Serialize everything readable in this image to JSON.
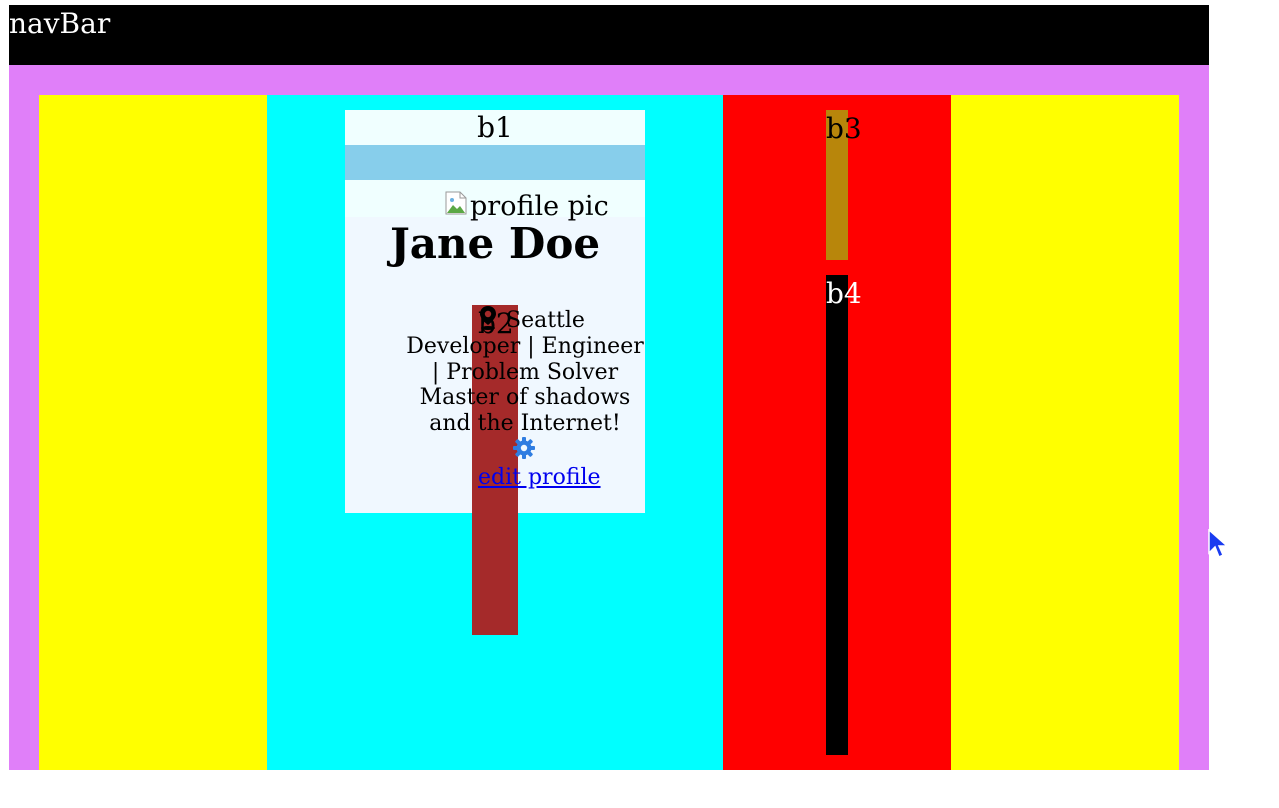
{
  "navbar": {
    "title": "navBar"
  },
  "blocks": {
    "b1": "b1",
    "b2": "b2",
    "b3": "b3",
    "b4": "b4"
  },
  "profile": {
    "image_alt": "profile pic",
    "name": "Jane Doe",
    "location": "Seattle",
    "tagline": "Developer | Engineer | Problem Solver",
    "bio": "Master of shadows and the Internet!",
    "edit_label": "edit profile"
  },
  "icons": {
    "location": "map-pin-icon",
    "settings": "gear-icon",
    "broken_image": "broken-image-icon",
    "cursor": "mouse-pointer-icon"
  },
  "colors": {
    "navbar": "#000000",
    "frame": "#e07ff9",
    "side_columns": "#ffff00",
    "center_column": "#00ffff",
    "red_column": "#ff0000",
    "card": "#f0f8ff",
    "banner": "#87ceeb",
    "b2": "#a52a2a",
    "b3": "#b8860b",
    "b4": "#000000",
    "link": "#0000ee",
    "gear": "#2f7de1"
  }
}
